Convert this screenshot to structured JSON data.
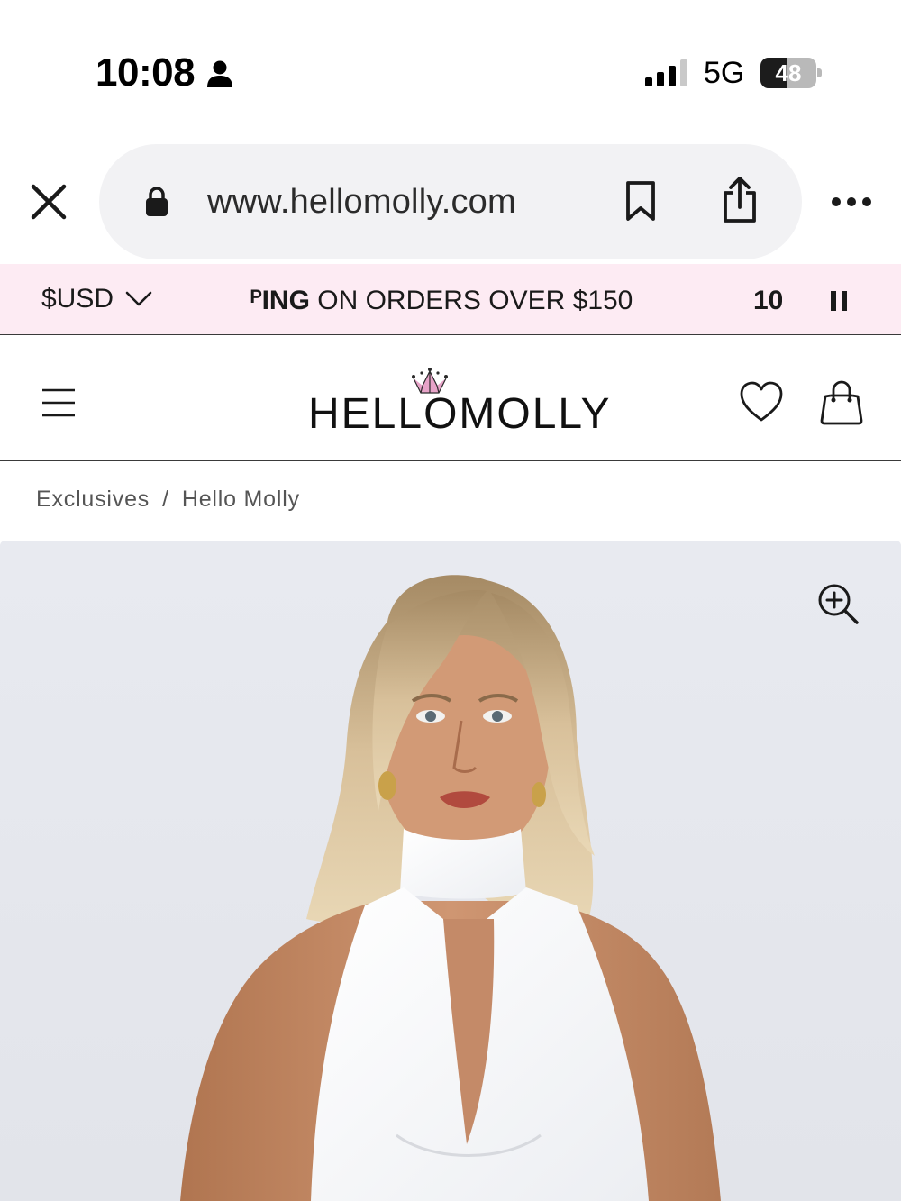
{
  "status_bar": {
    "time": "10:08",
    "network": "5G",
    "battery_percent": 48,
    "battery_label": "48"
  },
  "browser": {
    "url": "www.hellomolly.com",
    "icons": [
      "close-icon",
      "lock-icon",
      "bookmark-icon",
      "share-icon",
      "more-icon"
    ]
  },
  "promo_banner": {
    "currency": "$USD",
    "text_bold": "ᴾING",
    "text_rest": " ON ORDERS OVER $150",
    "next_text": "10",
    "background": "#fdebf3"
  },
  "header": {
    "logo": "HELLOMOLLY",
    "crown_color": "#e7a3c8",
    "icons": [
      "menu-icon",
      "crown-icon",
      "heart-icon",
      "bag-icon"
    ]
  },
  "breadcrumb": {
    "items": [
      "Exclusives",
      "Hello Molly"
    ],
    "separator": "/"
  },
  "product": {
    "icons": [
      "zoom-in-icon"
    ]
  }
}
